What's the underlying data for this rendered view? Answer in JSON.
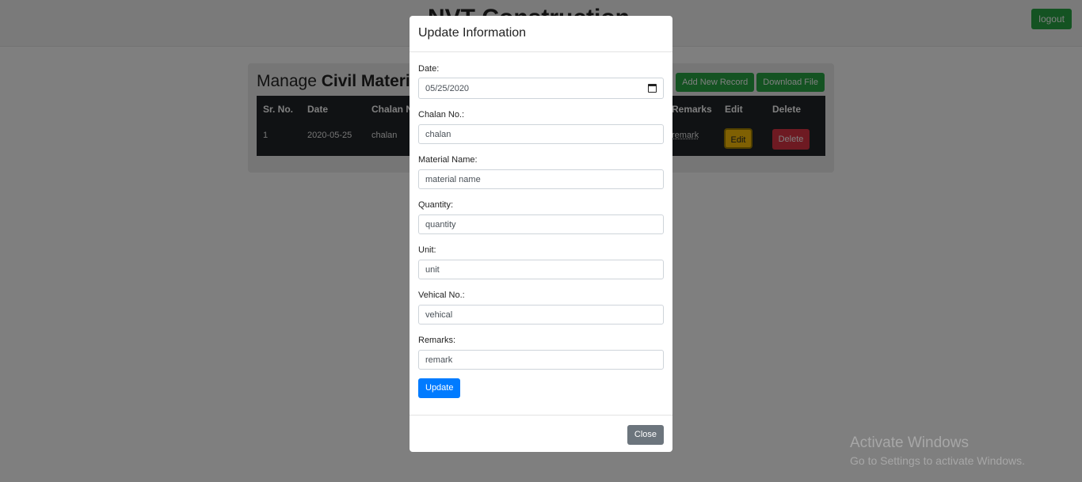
{
  "page": {
    "brand": "NVT Construction",
    "logout_label": "logout"
  },
  "panel": {
    "title_prefix": "Manage",
    "title_bold": "Civil Material",
    "add_label": "Add New Record",
    "download_label": "Download File"
  },
  "table": {
    "headers": [
      "Sr. No.",
      "Date",
      "Chalan No.",
      "Remarks",
      "Edit",
      "Delete"
    ],
    "row": {
      "sr": "1",
      "date": "2020-05-25",
      "chalan": "chalan",
      "remarks": "remark",
      "edit_label": "Edit",
      "delete_label": "Delete"
    }
  },
  "modal": {
    "title": "Update Information",
    "date_label": "Date:",
    "date_value": "05/25/2020",
    "chalan_label": "Chalan No.:",
    "chalan_value": "chalan",
    "material_label": "Material Name:",
    "material_value": "material name",
    "quantity_label": "Quantity:",
    "quantity_value": "quantity",
    "unit_label": "Unit:",
    "unit_value": "unit",
    "vehical_label": "Vehical No.:",
    "vehical_value": "vehical",
    "remarks_label": "Remarks:",
    "remarks_value": "remark",
    "update_label": "Update",
    "close_label": "Close"
  },
  "watermark": {
    "line1": "Activate Windows",
    "line2": "Go to Settings to activate Windows."
  },
  "colors": {
    "primary": "#007bff",
    "success": "#28a745",
    "warning": "#ffc107",
    "danger": "#dc3545",
    "secondary": "#6c757d",
    "table_dark": "#212529"
  },
  "icons": [
    "calendar-icon"
  ]
}
